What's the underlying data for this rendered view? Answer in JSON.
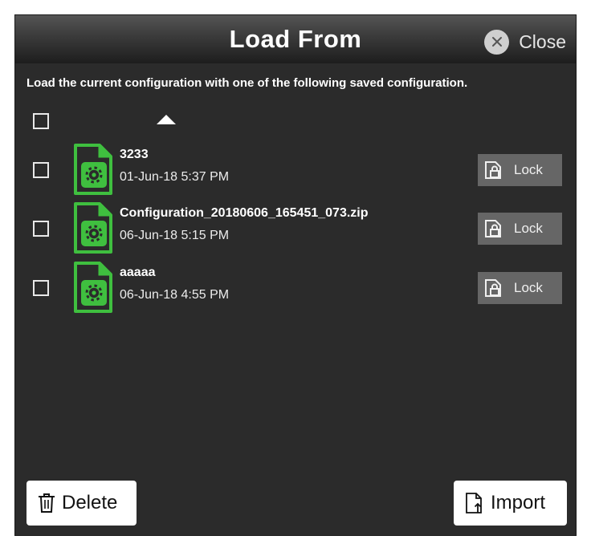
{
  "dialog": {
    "title": "Load From",
    "close_label": "Close",
    "instruction": "Load the current configuration with one of the following saved configuration."
  },
  "files": [
    {
      "name": "3233",
      "date": "01-Jun-18 5:37 PM",
      "lock_label": "Lock"
    },
    {
      "name": "Configuration_20180606_165451_073.zip",
      "date": "06-Jun-18 5:15 PM",
      "lock_label": "Lock"
    },
    {
      "name": "aaaaa",
      "date": "06-Jun-18 4:55 PM",
      "lock_label": "Lock"
    }
  ],
  "footer": {
    "delete_label": "Delete",
    "import_label": "Import"
  },
  "icons": {
    "file": "config-file-icon",
    "lock": "lock-icon",
    "close": "close-icon",
    "delete": "trash-icon",
    "import": "import-file-icon"
  },
  "colors": {
    "accent_green": "#3fbf3f",
    "background": "#2b2b2b",
    "lock_button": "#666666"
  }
}
